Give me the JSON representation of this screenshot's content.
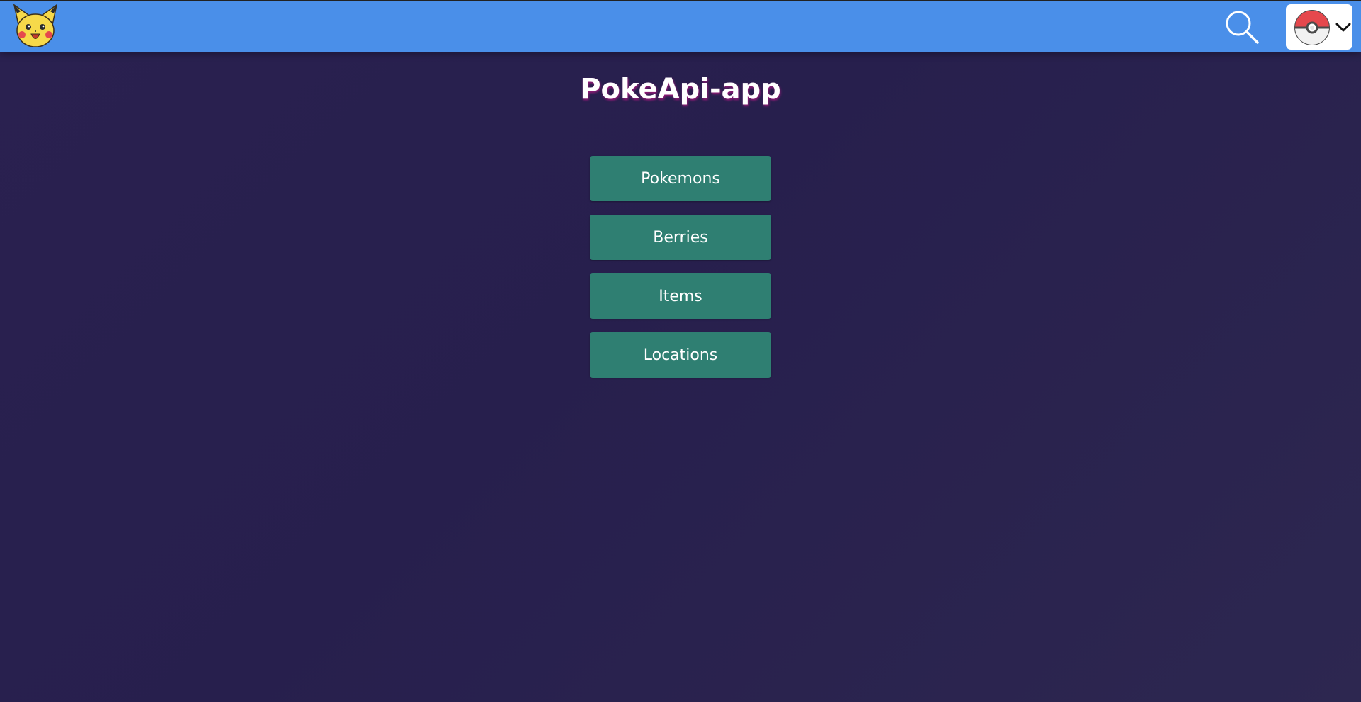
{
  "header": {
    "logo_icon": "pikachu-icon",
    "search_icon": "search-icon",
    "menu_icon": "pokeball-icon",
    "menu_chevron_icon": "chevron-down-icon",
    "bar_color": "#4a8fe9"
  },
  "main": {
    "title": "PokeApi-app",
    "nav_buttons": [
      {
        "label": "Pokemons"
      },
      {
        "label": "Berries"
      },
      {
        "label": "Items"
      },
      {
        "label": "Locations"
      }
    ],
    "button_color": "#2f7f72",
    "background_color": "#2a2150"
  }
}
